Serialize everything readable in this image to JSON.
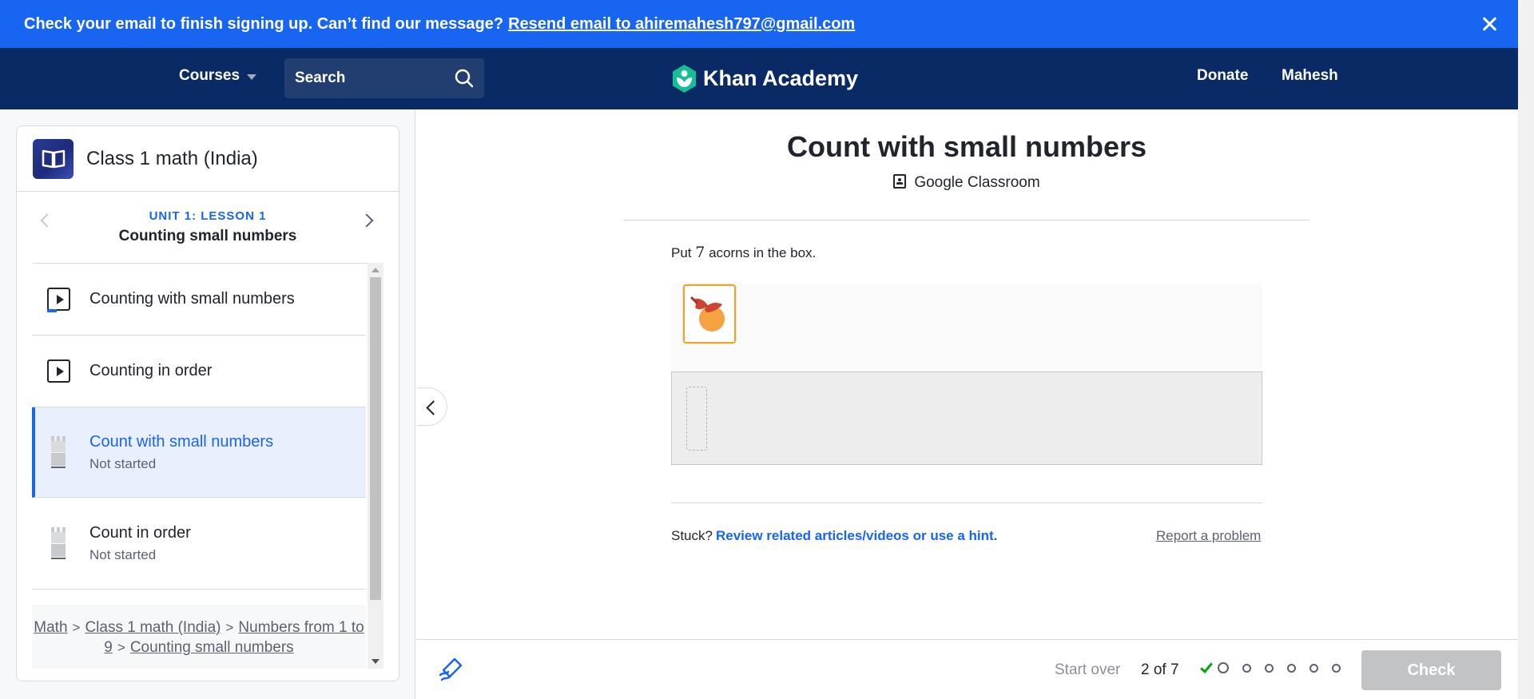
{
  "banner": {
    "message": "Check your email to finish signing up. Can’t find our message?",
    "link": "Resend email to ahiremahesh797@gmail.com"
  },
  "nav": {
    "courses": "Courses",
    "search_label": "Search",
    "brand": "Khan Academy",
    "donate": "Donate",
    "user": "Mahesh"
  },
  "sidebar": {
    "course_title": "Class 1 math (India)",
    "unit_label": "UNIT 1: LESSON 1",
    "lesson_name": "Counting small numbers",
    "items": [
      {
        "title": "Counting with small numbers",
        "type": "video"
      },
      {
        "title": "Counting in order",
        "type": "video"
      },
      {
        "title": "Count with small numbers",
        "status": "Not started",
        "type": "exercise"
      },
      {
        "title": "Count in order",
        "status": "Not started",
        "type": "exercise"
      }
    ],
    "breadcrumb": [
      "Math",
      "Class 1 math (India)",
      "Numbers from 1 to 9",
      "Counting small numbers"
    ]
  },
  "exercise": {
    "title": "Count with small numbers",
    "classroom": "Google Classroom",
    "prompt_before": "Put",
    "prompt_number": "7",
    "prompt_after": "acorns in the box.",
    "stuck": "Stuck?",
    "hint_link": "Review related articles/videos or use a hint.",
    "report": "Report a problem"
  },
  "footer": {
    "start_over": "Start over",
    "progress": "2 of 7",
    "check": "Check"
  },
  "colors": {
    "primary_blue": "#1865f2",
    "nav_navy": "#0a2a66",
    "success_green": "#00a60e"
  }
}
